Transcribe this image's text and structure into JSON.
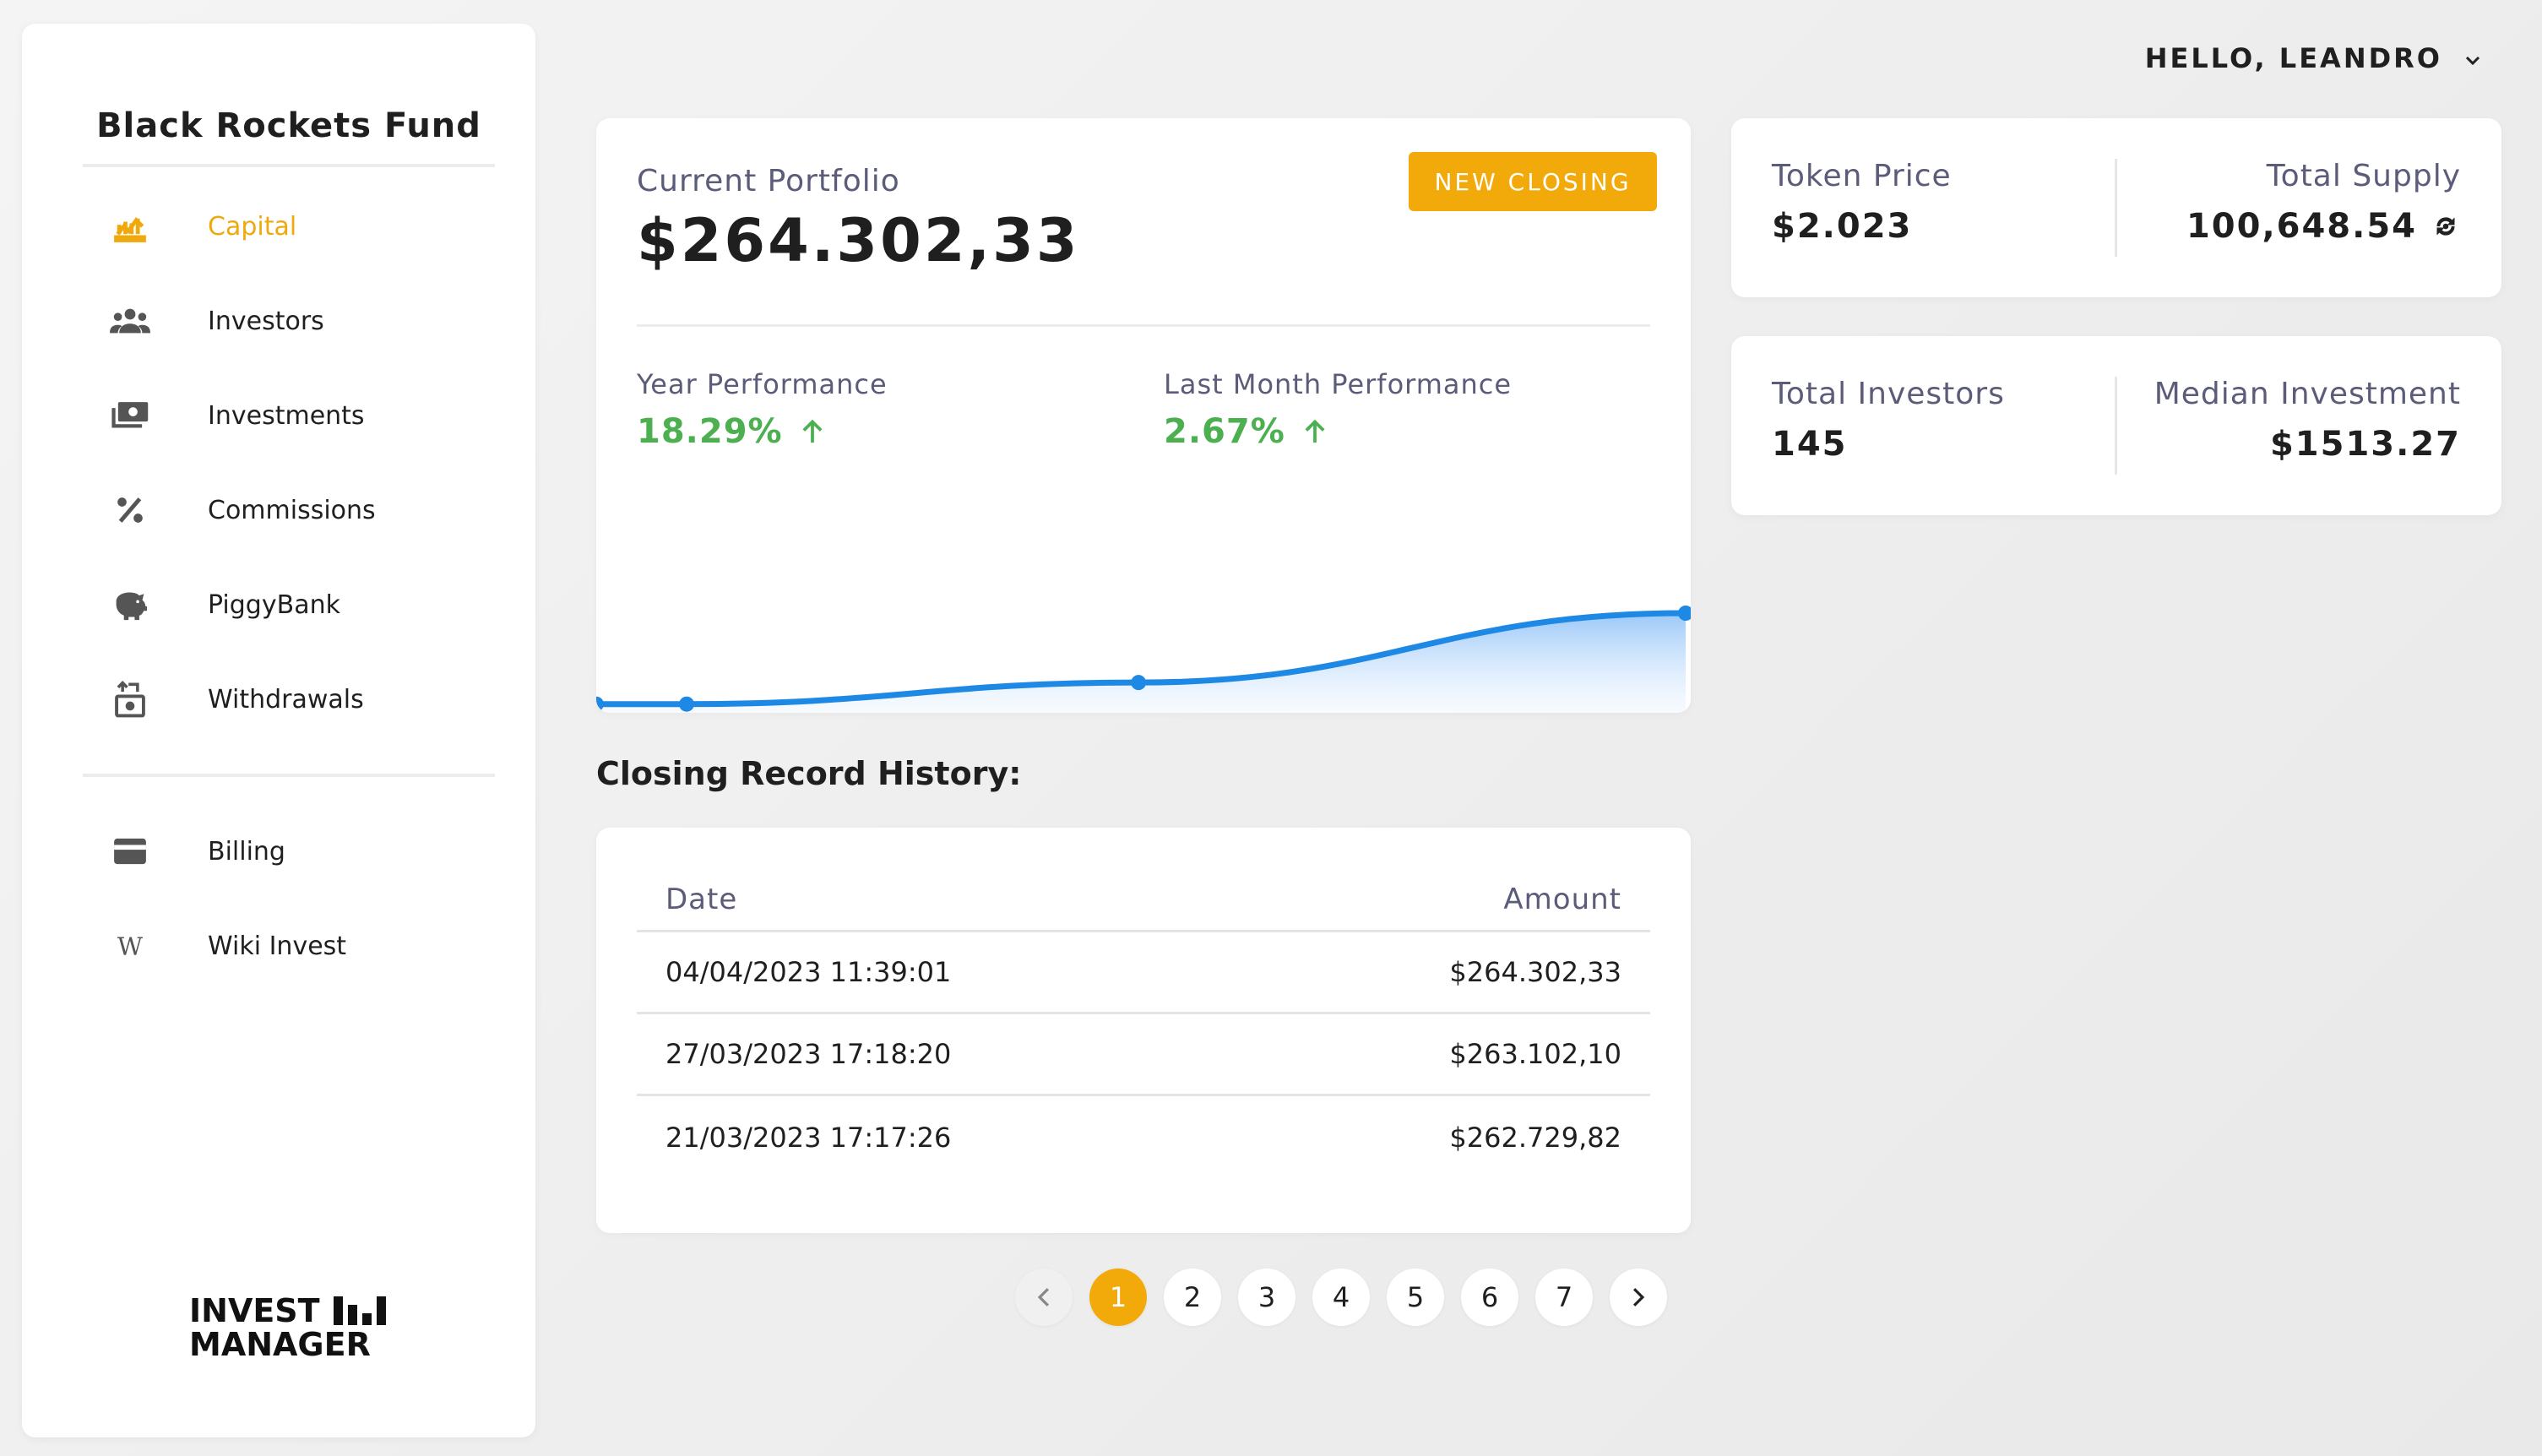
{
  "sidebar": {
    "fund_name": "Black Rockets Fund",
    "items": [
      {
        "label": "Capital",
        "icon": "capital-icon",
        "active": true
      },
      {
        "label": "Investors",
        "icon": "investors-icon"
      },
      {
        "label": "Investments",
        "icon": "investments-icon"
      },
      {
        "label": "Commissions",
        "icon": "percent-icon"
      },
      {
        "label": "PiggyBank",
        "icon": "piggy-bank-icon"
      },
      {
        "label": "Withdrawals",
        "icon": "withdrawals-icon"
      }
    ],
    "secondary_items": [
      {
        "label": "Billing",
        "icon": "credit-card-icon"
      },
      {
        "label": "Wiki Invest",
        "icon": "wikipedia-icon"
      }
    ],
    "brand_line1": "INVEST",
    "brand_line2": "MANAGER"
  },
  "header": {
    "greeting": "HELLO, LEANDRO"
  },
  "portfolio": {
    "label": "Current Portfolio",
    "value": "$264.302,33",
    "new_closing_label": "NEW CLOSING",
    "year_label": "Year Performance",
    "year_value": "18.29%",
    "month_label": "Last Month Performance",
    "month_value": "2.67%"
  },
  "chart_data": {
    "type": "area",
    "series": [
      {
        "values": [
          262.729,
          262.729,
          263.102,
          264.302
        ]
      }
    ]
  },
  "history": {
    "title": "Closing Record History:",
    "columns": [
      "Date",
      "Amount"
    ],
    "rows": [
      {
        "date": "04/04/2023 11:39:01",
        "amount": "$264.302,33"
      },
      {
        "date": "27/03/2023 17:18:20",
        "amount": "$263.102,10"
      },
      {
        "date": "21/03/2023 17:17:26",
        "amount": "$262.729,82"
      }
    ]
  },
  "pagination": {
    "pages": [
      "1",
      "2",
      "3",
      "4",
      "5",
      "6",
      "7"
    ],
    "current": "1"
  },
  "stats": {
    "token_price_label": "Token Price",
    "token_price": "$2.023",
    "total_supply_label": "Total Supply",
    "total_supply": "100,648.54",
    "total_investors_label": "Total Investors",
    "total_investors": "145",
    "median_investment_label": "Median Investment",
    "median_investment": "$1513.27"
  },
  "colors": {
    "accent": "#f2aa0b",
    "positive": "#4caf50",
    "line": "#1e88e5"
  }
}
